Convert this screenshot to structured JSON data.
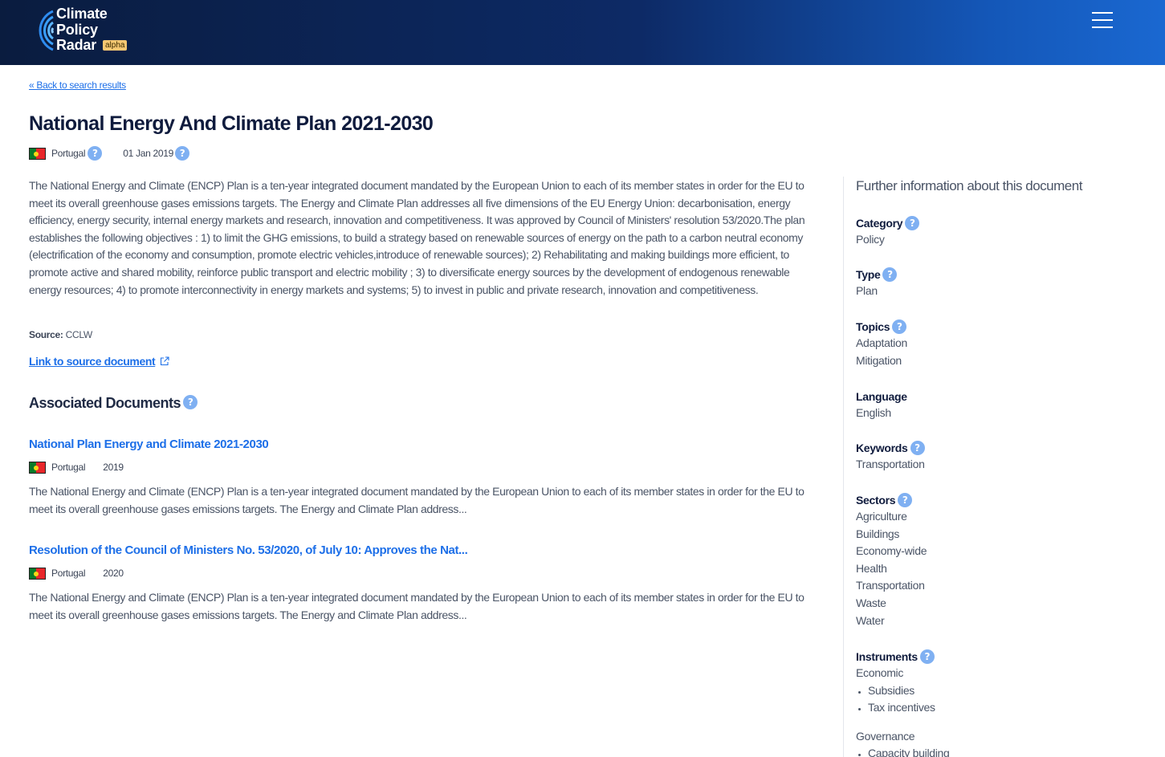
{
  "header": {
    "logo_lines": [
      "Climate",
      "Policy",
      "Radar"
    ],
    "badge": "alpha",
    "menu_icon": "hamburger-icon"
  },
  "back_link": "« Back to search results",
  "document": {
    "title": "National Energy And Climate Plan 2021-2030",
    "country": "Portugal",
    "date": "01 Jan 2019",
    "summary": "The National Energy and Climate (ENCP) Plan is a ten-year integrated document mandated by the European Union to each of its member states in order for the EU to meet its overall greenhouse gases emissions targets.  The Energy and Climate Plan addresses all five dimensions of the EU Energy Union: decarbonisation, energy efficiency, energy security, internal energy markets and research, innovation and competitiveness. It was approved by Council of Ministers' resolution 53/2020.The plan establishes the following objectives : 1) to limit the GHG emissions, to build a strategy based on renewable sources of energy on the path to a carbon neutral economy (electrification of the economy and consumption, promote electric vehicles,introduce of renewable sources); 2) Rehabilitating and making buildings more efficient, to promote active and shared mobility, reinforce public transport and electric mobility ; 3) to diversificate energy sources by the development of endogenous renewable energy resources; 4) to promote interconnectivity in energy markets and systems; 5) to invest in public and private research, innovation and competitiveness.",
    "source_label": "Source:",
    "source_value": "CCLW",
    "source_link": "Link to source document"
  },
  "associated": {
    "heading": "Associated Documents",
    "items": [
      {
        "title": "National Plan Energy and Climate 2021-2030",
        "country": "Portugal",
        "year": "2019",
        "description": "The National Energy and Climate (ENCP) Plan is a ten-year integrated document mandated by the European Union to each of its member states in order for the EU to meet its overall greenhouse gases emissions targets.  The Energy and Climate Plan address..."
      },
      {
        "title": "Resolution of the Council of Ministers No. 53/2020, of July 10: Approves the Nat...",
        "country": "Portugal",
        "year": "2020",
        "description": "The National Energy and Climate (ENCP) Plan is a ten-year integrated document mandated by the European Union to each of its member states in order for the EU to meet its overall greenhouse gases emissions targets.  The Energy and Climate Plan address..."
      }
    ]
  },
  "sidebar": {
    "heading": "Further information about this document",
    "category": {
      "label": "Category",
      "values": [
        "Policy"
      ]
    },
    "type": {
      "label": "Type",
      "values": [
        "Plan"
      ]
    },
    "topics": {
      "label": "Topics",
      "values": [
        "Adaptation",
        "Mitigation"
      ]
    },
    "language": {
      "label": "Language",
      "values": [
        "English"
      ]
    },
    "keywords": {
      "label": "Keywords",
      "values": [
        "Transportation"
      ]
    },
    "sectors": {
      "label": "Sectors",
      "values": [
        "Agriculture",
        "Buildings",
        "Economy-wide",
        "Health",
        "Transportation",
        "Waste",
        "Water"
      ]
    },
    "instruments": {
      "label": "Instruments",
      "groups": [
        {
          "name": "Economic",
          "items": [
            "Subsidies",
            "Tax incentives"
          ]
        },
        {
          "name": "Governance",
          "items": [
            "Capacity building"
          ]
        }
      ]
    }
  },
  "colors": {
    "link": "#1d6fe8",
    "help_badge": "#7fb0f2",
    "header_dark": "#0a1c3f",
    "header_light": "#1a68d1",
    "badge": "#f5c772"
  }
}
